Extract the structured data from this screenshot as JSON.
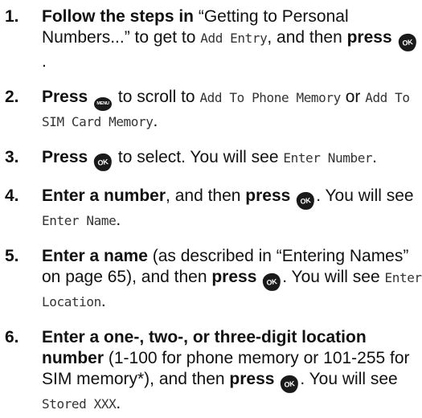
{
  "steps": [
    {
      "num": "1.",
      "t1": "Follow the steps in",
      "t2": " “Getting to Personal Numbers...” to get to ",
      "lcd1": "Add Entry",
      "t3": ", and then ",
      "t4": "press",
      "t5": "."
    },
    {
      "num": "2.",
      "t1": "Press",
      "t2": " to scroll to ",
      "lcd1": "Add To Phone Memory",
      "t3": " or ",
      "lcd2": "Add To SIM Card Memory",
      "t4": "."
    },
    {
      "num": "3.",
      "t1": "Press",
      "t2": " to select. You will see ",
      "lcd1": "Enter Number",
      "t3": "."
    },
    {
      "num": "4.",
      "t1": "Enter a number",
      "t2": ", and then ",
      "t3": "press",
      "t4": ". You will see ",
      "lcd1": "Enter Name",
      "t5": "."
    },
    {
      "num": "5.",
      "t1": "Enter a name",
      "t2": " (as described in “Entering Names” on page 65), and then ",
      "t3": "press",
      "t4": ". You will see ",
      "lcd1": "Enter Location",
      "t5": "."
    },
    {
      "num": "6.",
      "t1": "Enter a one-, two-, or three-digit location number",
      "t2": " (1-100 for phone memory or 101-255 for SIM memory*), and then ",
      "t3": "press",
      "t4": ". You will see ",
      "lcd1": "Stored XXX",
      "t5": "."
    }
  ],
  "icons": {
    "ok_label": "OK",
    "menu_label": "MENU"
  }
}
